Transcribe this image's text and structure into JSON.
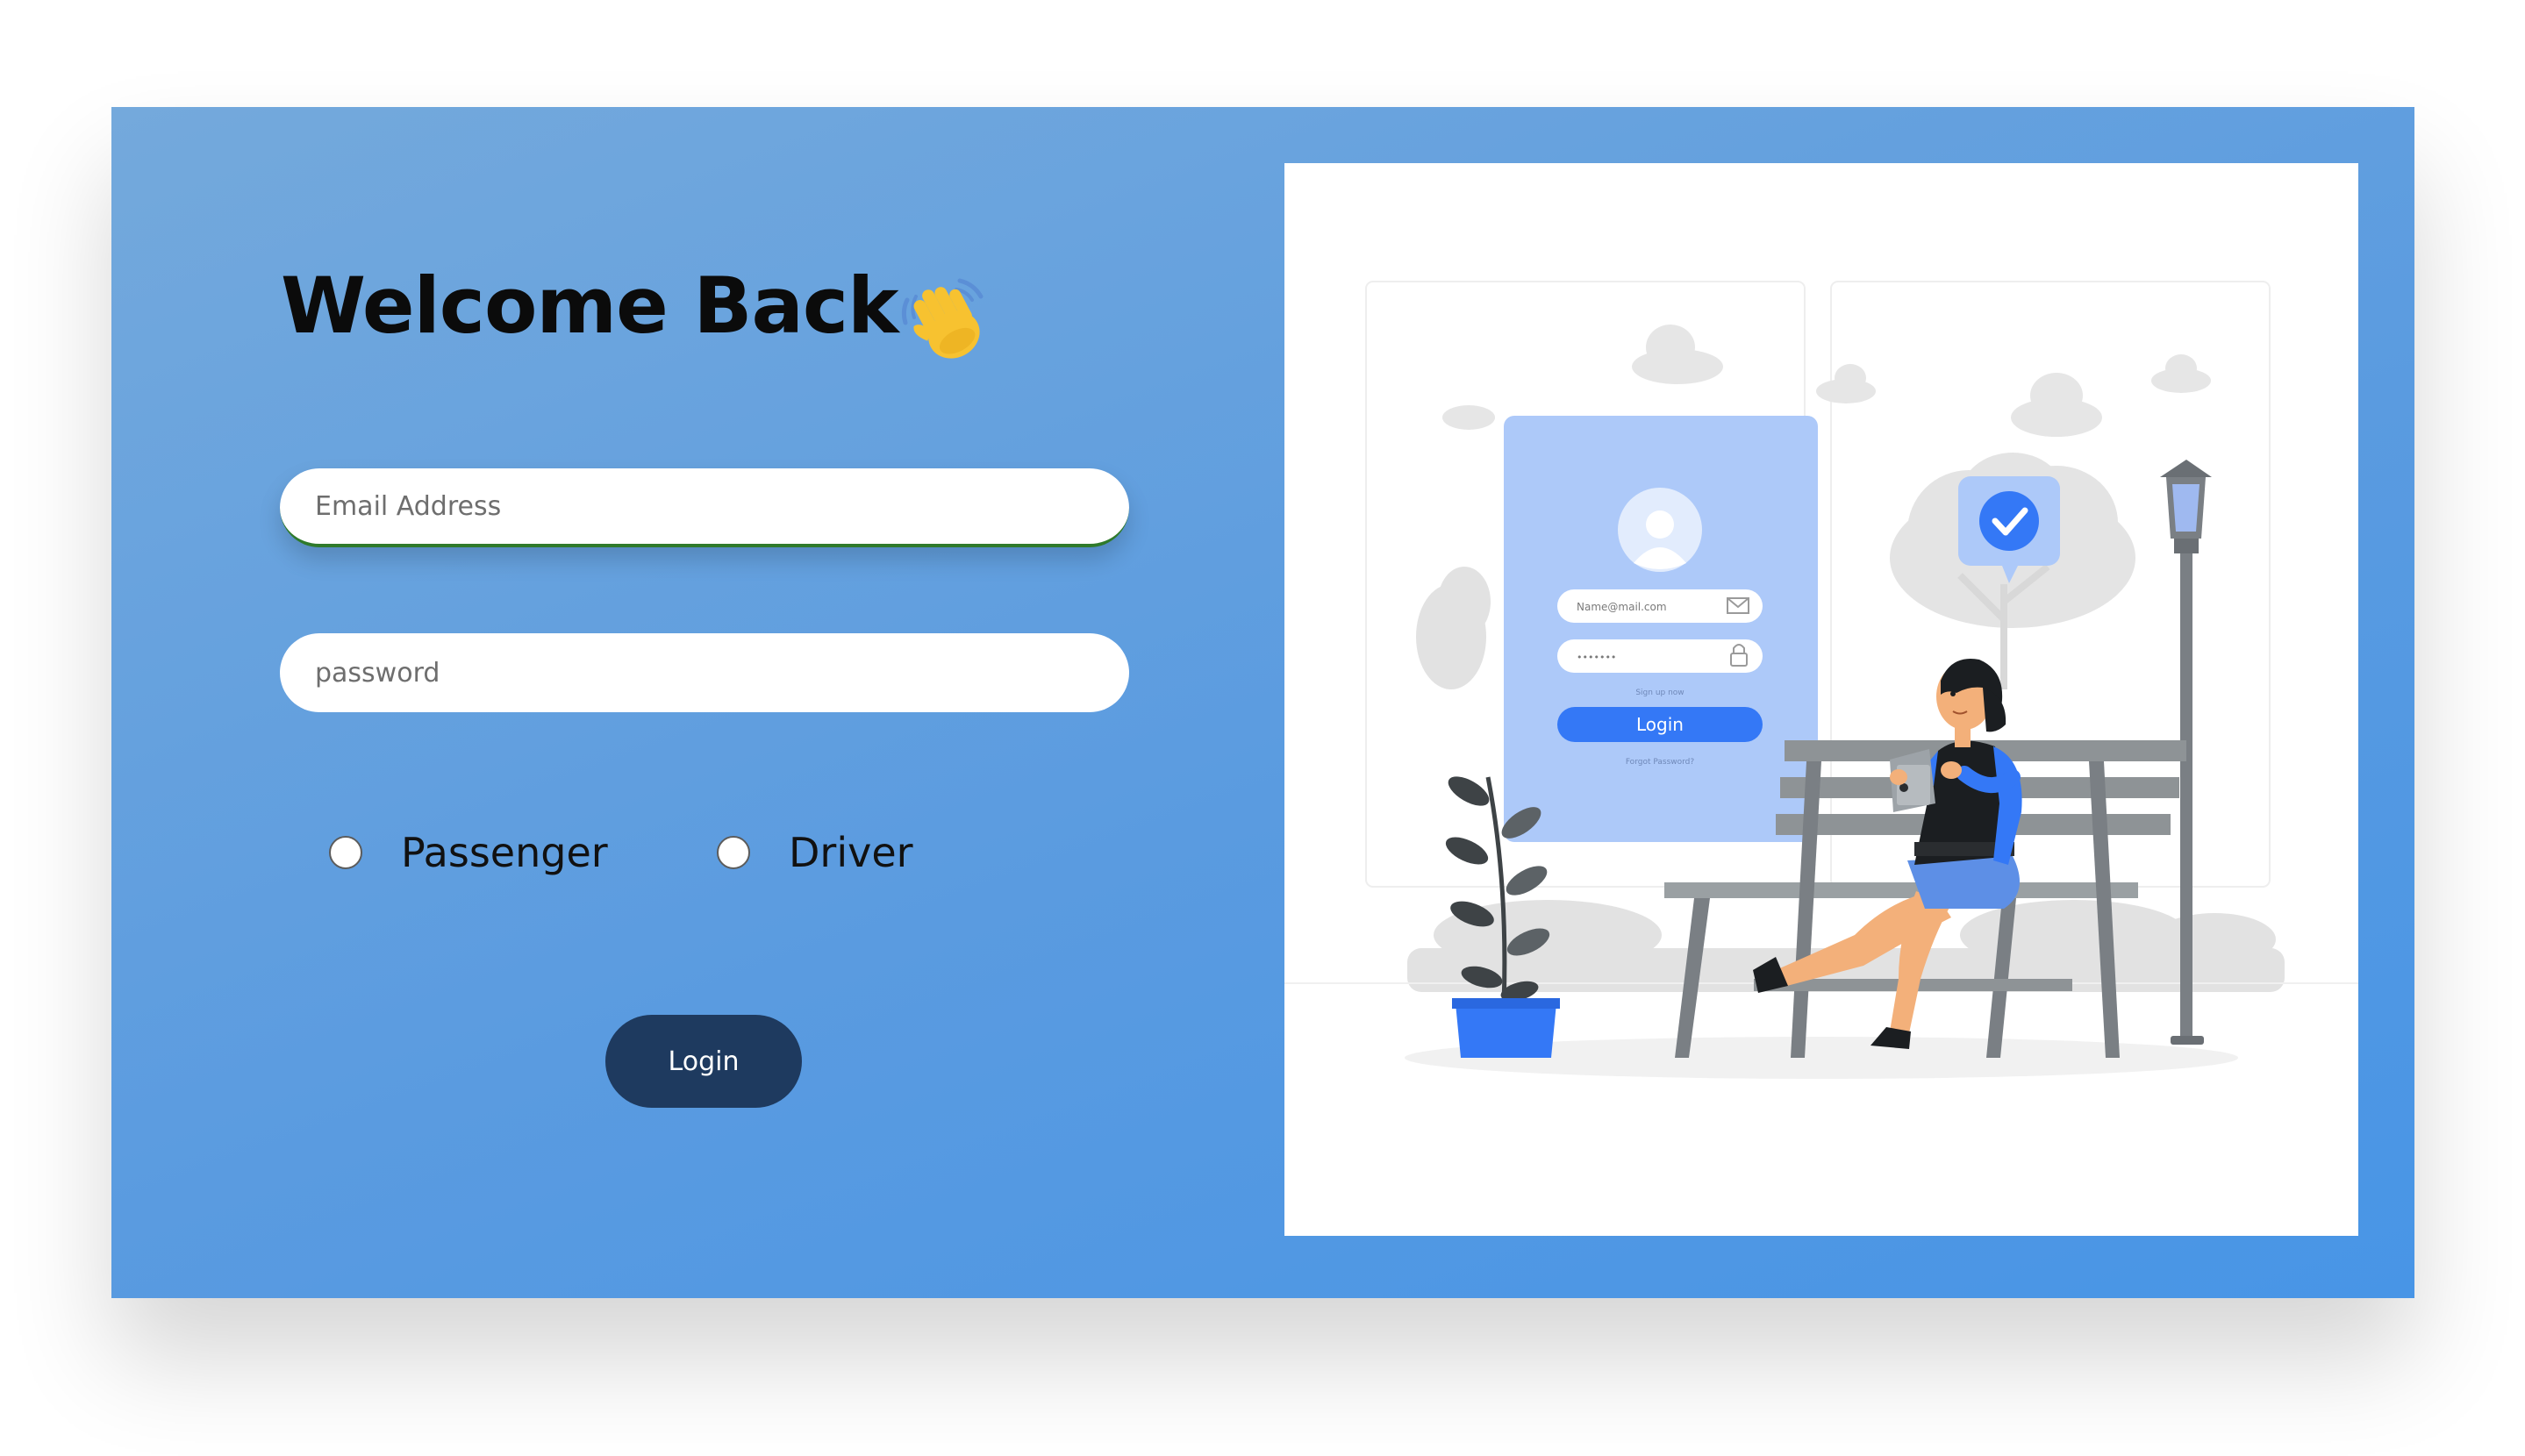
{
  "heading": {
    "title": "Welcome Back",
    "emoji_icon": "waving-hand-icon"
  },
  "form": {
    "email_placeholder": "Email Address",
    "email_value": "",
    "password_placeholder": "password",
    "password_value": "",
    "roles": [
      {
        "label": "Passenger",
        "selected": false
      },
      {
        "label": "Driver",
        "selected": false
      }
    ],
    "login_label": "Login"
  },
  "illustration": {
    "mock_email_placeholder": "Name@mail.com",
    "mock_password_mask": "•••••••",
    "mock_signup_text": "Sign up now",
    "mock_login_label": "Login",
    "mock_forgot_text": "Forgot Password?"
  },
  "colors": {
    "panel_gradient_start": "#74a9dc",
    "panel_gradient_end": "#4895e6",
    "login_button": "#1e3a5f",
    "accent_blue": "#3478f6",
    "mock_card": "#adc9f9"
  }
}
